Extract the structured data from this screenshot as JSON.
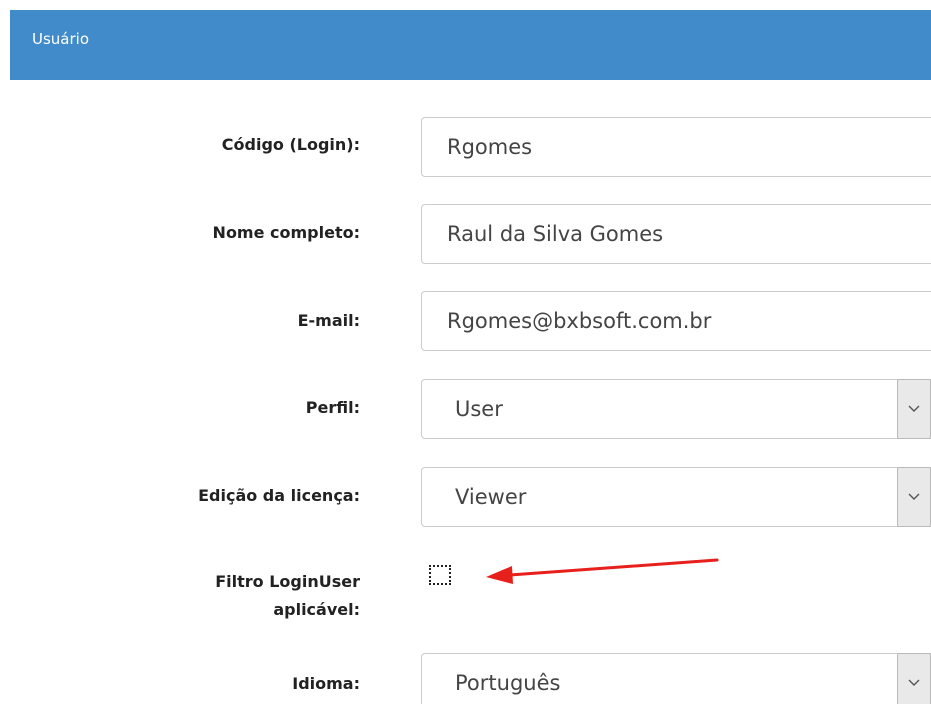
{
  "header": {
    "title": "Usuário"
  },
  "form": {
    "login": {
      "label": "Código (Login):",
      "value": "Rgomes"
    },
    "full_name": {
      "label": "Nome completo:",
      "value": "Raul da Silva Gomes"
    },
    "email": {
      "label": "E-mail:",
      "value": "Rgomes@bxbsoft.com.br"
    },
    "profile": {
      "label": "Perfil:",
      "selected": "User"
    },
    "license_edition": {
      "label": "Edição da licença:",
      "selected": "Viewer"
    },
    "loginuser_filter": {
      "label_line1": "Filtro LoginUser",
      "label_line2": "aplicável:",
      "checked": false
    },
    "language": {
      "label": "Idioma:",
      "selected": "Português"
    }
  },
  "colors": {
    "header_bg": "#428bca",
    "annotation_arrow": "#e8201c"
  },
  "icons": {
    "select_toggle": "chevron-down-icon"
  }
}
